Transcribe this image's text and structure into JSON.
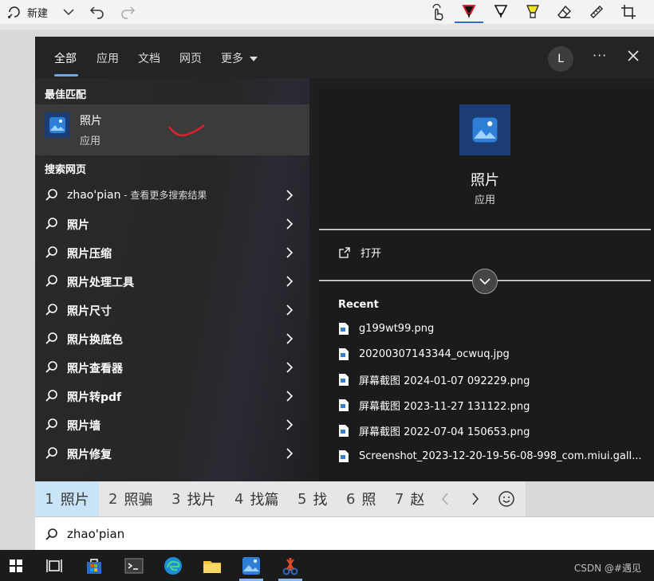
{
  "toolbar": {
    "new_label": "新建",
    "pen_accent": "#d9232e",
    "highlighter_accent": "#f1e32b"
  },
  "tabs": [
    {
      "label": "全部"
    },
    {
      "label": "应用"
    },
    {
      "label": "文档"
    },
    {
      "label": "网页"
    },
    {
      "label": "更多"
    }
  ],
  "user_initial": "L",
  "more_options": "···",
  "best_match": {
    "section_title": "最佳匹配",
    "name": "照片",
    "type": "应用"
  },
  "web_search": {
    "section_title": "搜索网页",
    "first": {
      "query": "zhao'pian",
      "suffix": " - 查看更多搜索结果"
    },
    "items": [
      "照片",
      "照片压缩",
      "照片处理工具",
      "照片尺寸",
      "照片换底色",
      "照片查看器",
      "照片转pdf",
      "照片墙",
      "照片修复"
    ]
  },
  "detail": {
    "name": "照片",
    "type": "应用",
    "open_label": "打开",
    "recent_title": "Recent",
    "recent_files": [
      "g199wt99.png",
      "20200307143344_ocwuq.jpg",
      "屏幕截图 2024-01-07 092229.png",
      "屏幕截图 2023-11-27 131122.png",
      "屏幕截图 2022-07-04 150653.png",
      "Screenshot_2023-12-20-19-56-08-998_com.miui.gall..."
    ]
  },
  "ime": {
    "candidates": [
      {
        "num": "1",
        "text": "照片"
      },
      {
        "num": "2",
        "text": "照骗"
      },
      {
        "num": "3",
        "text": "找片"
      },
      {
        "num": "4",
        "text": "找篇"
      },
      {
        "num": "5",
        "text": "找"
      },
      {
        "num": "6",
        "text": "照"
      },
      {
        "num": "7",
        "text": "赵"
      }
    ]
  },
  "search": {
    "value": "zhao'pian"
  },
  "taskbar": {
    "watermark": "CSDN @#遇见"
  },
  "colors": {
    "accent": "#6aa9e6",
    "tile": "#1c3c74",
    "highlight": "#c9e4f6"
  }
}
